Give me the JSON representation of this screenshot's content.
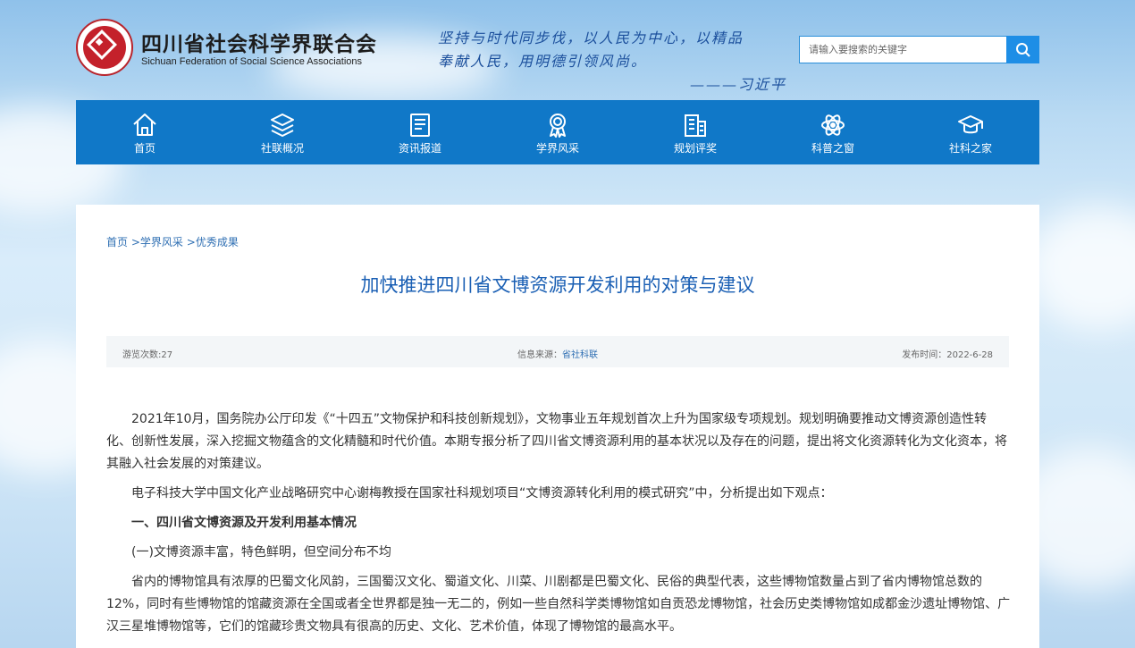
{
  "header": {
    "org_name_cn": "四川省社会科学界联合会",
    "org_name_en": "Sichuan Federation of Social Science Associations",
    "quote_line1": "坚持与时代同步伐，以人民为中心，以精品",
    "quote_line2": "奉献人民，用明德引领风尚。",
    "quote_author": "———习近平"
  },
  "search": {
    "placeholder": "请输入要搜索的关键字"
  },
  "nav": [
    {
      "label": "首页",
      "icon": "home-icon"
    },
    {
      "label": "社联概况",
      "icon": "layers-icon"
    },
    {
      "label": "资讯报道",
      "icon": "document-icon"
    },
    {
      "label": "学界风采",
      "icon": "medal-icon"
    },
    {
      "label": "规划评奖",
      "icon": "building-icon"
    },
    {
      "label": "科普之窗",
      "icon": "atom-icon"
    },
    {
      "label": "社科之家",
      "icon": "graduation-cap-icon"
    }
  ],
  "breadcrumb": [
    "首页",
    "学界风采",
    "优秀成果"
  ],
  "breadcrumb_sep": ">",
  "article": {
    "title": "加快推进四川省文博资源开发利用的对策与建议",
    "views_label": "游览次数:",
    "views": "27",
    "source_label": "信息来源：",
    "source": "省社科联",
    "date_label": "发布时间：",
    "date": "2022-6-28",
    "paragraphs": [
      "2021年10月，国务院办公厅印发《“十四五”文物保护和科技创新规划》，文物事业五年规划首次上升为国家级专项规划。规划明确要推动文博资源创造性转化、创新性发展，深入挖掘文物蕴含的文化精髓和时代价值。本期专报分析了四川省文博资源利用的基本状况以及存在的问题，提出将文化资源转化为文化资本，将其融入社会发展的对策建议。",
      "电子科技大学中国文化产业战略研究中心谢梅教授在国家社科规划项目“文博资源转化利用的模式研究”中，分析提出如下观点：",
      "一、四川省文博资源及开发利用基本情况",
      "(一)文博资源丰富，特色鲜明，但空间分布不均",
      "省内的博物馆具有浓厚的巴蜀文化风韵，三国蜀汉文化、蜀道文化、川菜、川剧都是巴蜀文化、民俗的典型代表，这些博物馆数量占到了省内博物馆总数的12%，同时有些博物馆的馆藏资源在全国或者全世界都是独一无二的，例如一些自然科学类博物馆如自贡恐龙博物馆，社会历史类博物馆如成都金沙遗址博物馆、广汉三星堆博物馆等，它们的馆藏珍贵文物具有很高的历史、文化、艺术价值，体现了博物馆的最高水平。"
    ]
  },
  "colors": {
    "nav_bg": "#1078c8",
    "title": "#1a5fb4",
    "link": "#2f6fb3",
    "brand_red": "#c4212b"
  }
}
